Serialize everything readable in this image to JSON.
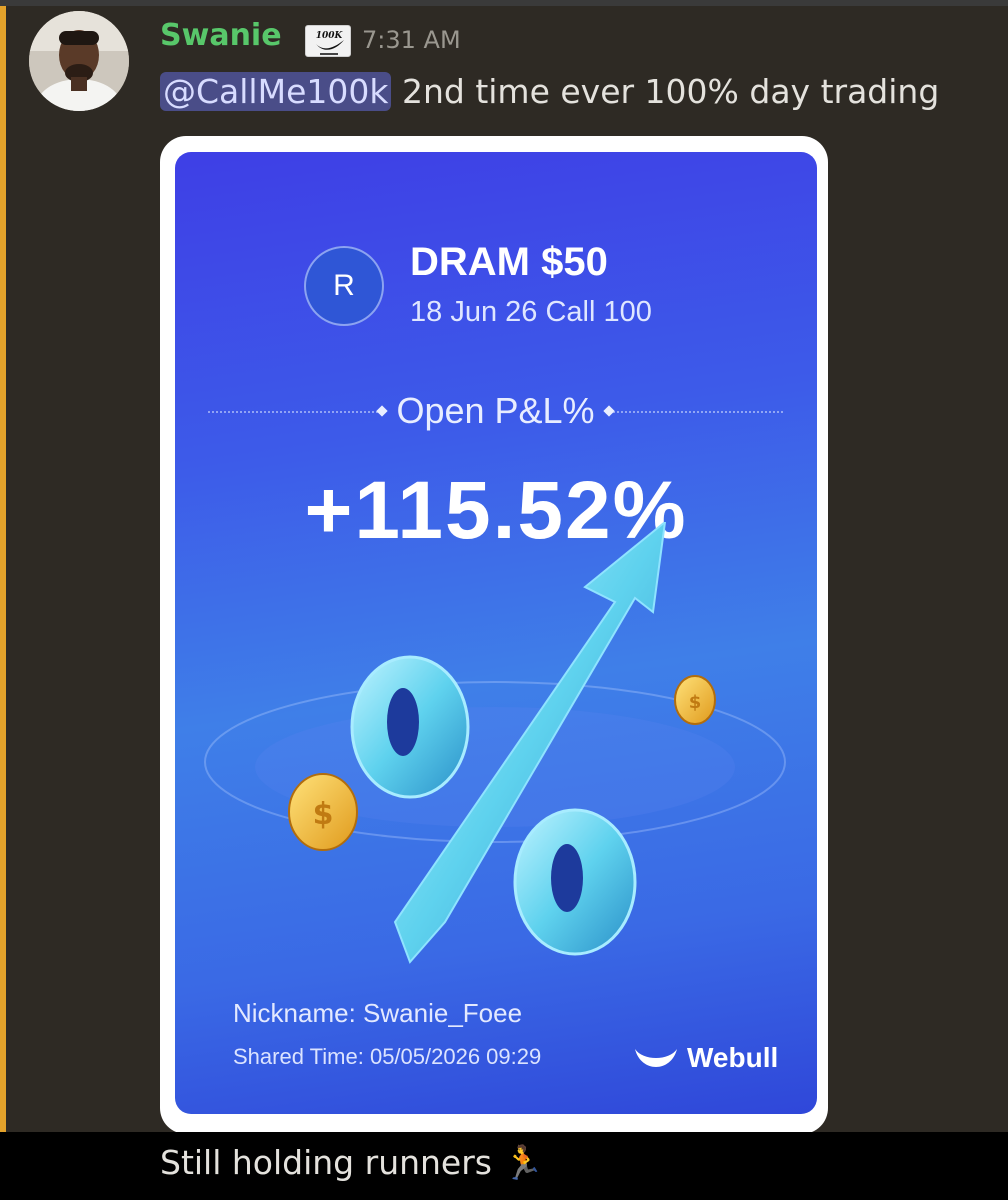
{
  "message": {
    "username": "Swanie",
    "role_badge": "100K",
    "timestamp": "7:31 AM",
    "mention": "@CallMe100k",
    "text": " 2nd time ever 100% day trading"
  },
  "share_card": {
    "ticker_letter": "R",
    "title": "DRAM $50",
    "subtitle": "18 Jun 26 Call 100",
    "metric_label": "Open P&L%",
    "metric_value": "+115.52%",
    "nickname": "Nickname: Swanie_Foee",
    "shared_time": "Shared Time: 05/05/2026 09:29",
    "brand": "Webull"
  },
  "next_message": {
    "text": "Still holding runners",
    "emoji": "🏃"
  },
  "colors": {
    "username": "#58c76a",
    "mention_bg": "#4a4d88",
    "mention_stripe": "#e3a22b",
    "card_blue": "#3d5be9"
  }
}
